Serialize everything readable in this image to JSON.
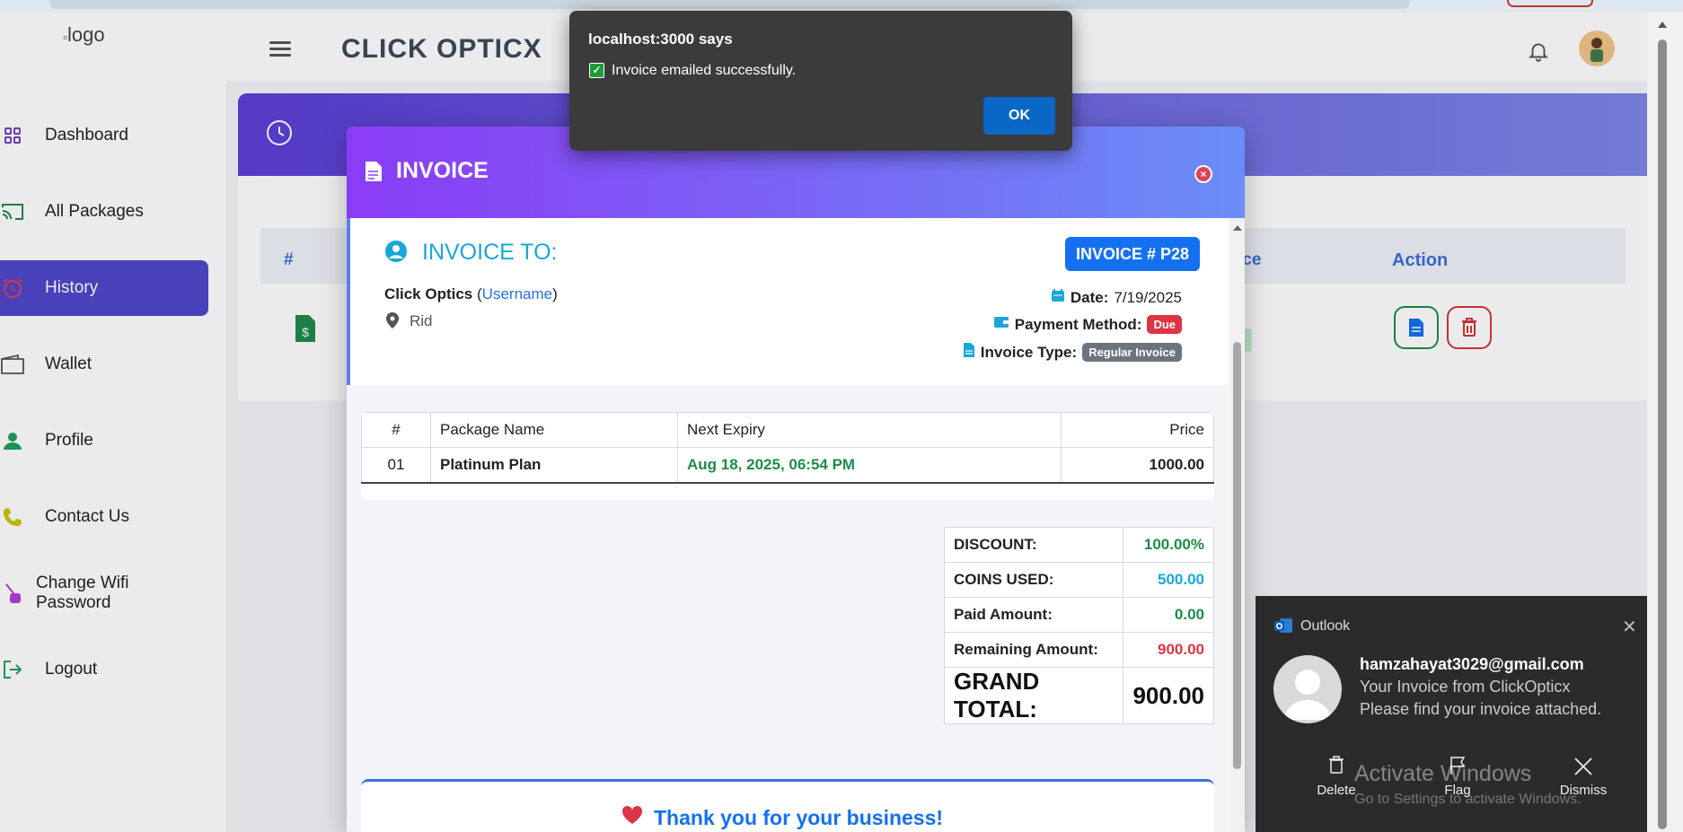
{
  "header": {
    "logo_alt": "logo",
    "brand": "CLICK OPTICX"
  },
  "sidebar": {
    "items": [
      {
        "label": "Dashboard",
        "icon": "grid-icon",
        "color": "#6f42c1"
      },
      {
        "label": "All Packages",
        "icon": "cast-icon",
        "color": "#1f8a4c"
      },
      {
        "label": "History",
        "icon": "alarm-clock-icon",
        "color": "#e0405a"
      },
      {
        "label": "Wallet",
        "icon": "wallet-icon",
        "color": "#555555"
      },
      {
        "label": "Profile",
        "icon": "user-icon",
        "color": "#1f9f5e"
      },
      {
        "label": "Contact Us",
        "icon": "phone-icon",
        "color": "#c9c30f"
      },
      {
        "label": "Change Wifi Password",
        "icon": "password-icon",
        "color": "#b03fd8"
      },
      {
        "label": "Logout",
        "icon": "logout-icon",
        "color": "#1f9f5e"
      }
    ],
    "active": "History"
  },
  "table": {
    "col_hash": "#",
    "col_price_partial": "ice",
    "col_action": "Action"
  },
  "modal": {
    "title": "INVOICE",
    "invoice_to_label": "INVOICE TO:",
    "customer_name": "Click Optics",
    "username_link": "Username",
    "location": "Rid",
    "invoice_number": "INVOICE # P28",
    "date_label": "Date:",
    "date_value": "7/19/2025",
    "payment_method_label": "Payment Method:",
    "payment_method_badge": "Due",
    "invoice_type_label": "Invoice Type:",
    "invoice_type_badge": "Regular Invoice",
    "items_headers": [
      "#",
      "Package Name",
      "Next Expiry",
      "Price"
    ],
    "items": [
      {
        "num": "01",
        "package": "Platinum Plan",
        "expiry": "Aug 18, 2025, 06:54 PM",
        "price": "1000.00"
      }
    ],
    "totals": {
      "discount_label": "DISCOUNT:",
      "discount_value": "100.00%",
      "coins_label": "COINS USED:",
      "coins_value": "500.00",
      "paid_label": "Paid Amount:",
      "paid_value": "0.00",
      "remaining_label": "Remaining Amount:",
      "remaining_value": "900.00",
      "grand_label": "GRAND TOTAL:",
      "grand_value": "900.00"
    },
    "thanks": "Thank you for your business!"
  },
  "alert": {
    "title": "localhost:3000 says",
    "message": "Invoice emailed successfully.",
    "ok": "OK"
  },
  "toast": {
    "app": "Outlook",
    "from": "hamzahayat3029@gmail.com",
    "subject": "Your Invoice from ClickOpticx",
    "body": "Please find your invoice attached.",
    "actions": {
      "delete": "Delete",
      "flag": "Flag",
      "dismiss": "Dismiss"
    }
  },
  "watermark": {
    "line1": "Activate Windows",
    "line2": "Go to Settings to activate Windows."
  },
  "colors": {
    "accent": "#4f47c9",
    "header_gradient_start": "#8a3cf5",
    "header_gradient_end": "#6a8df7",
    "success": "#1f8a4c",
    "danger": "#dc3545",
    "info": "#1aa6d8"
  }
}
